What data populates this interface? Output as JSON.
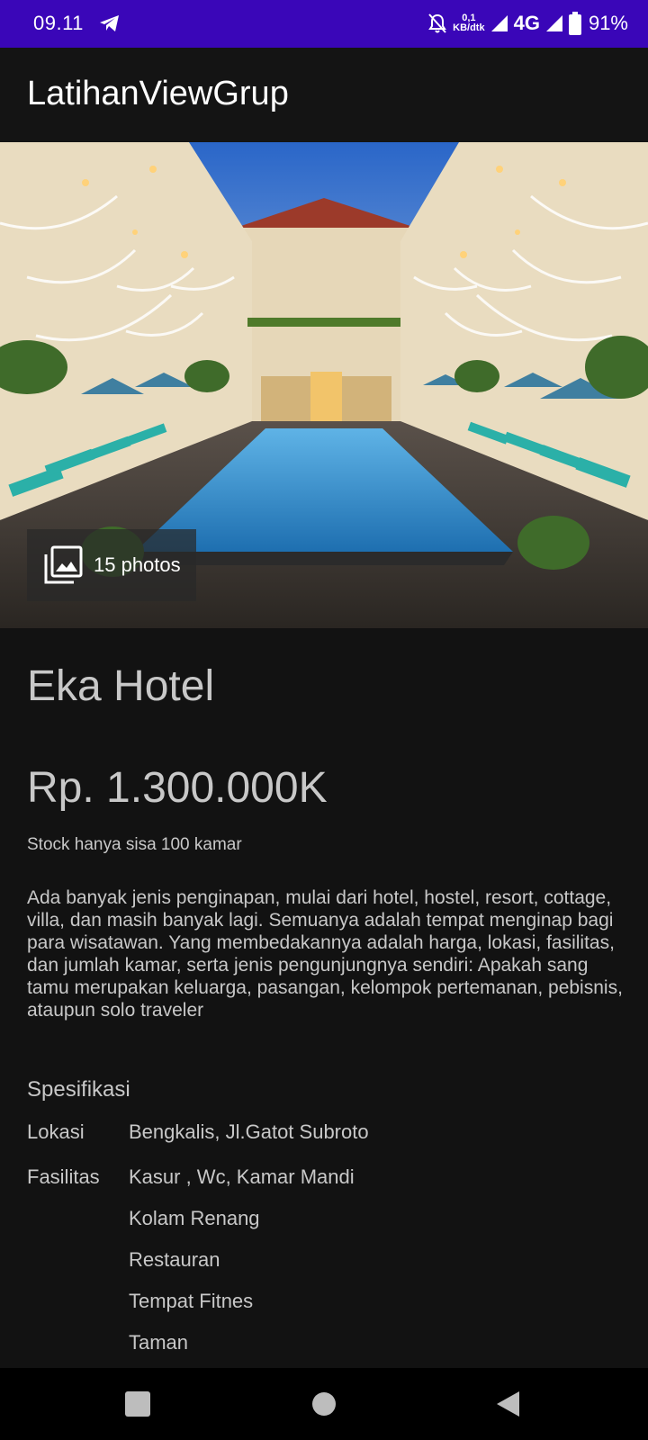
{
  "status_bar": {
    "time": "09.11",
    "net_speed_value": "0,1",
    "net_speed_unit": "KB/dtk",
    "network_type": "4G",
    "battery_percent": "91%",
    "background_color": "#3a06b8"
  },
  "app_bar": {
    "title": "LatihanViewGrup"
  },
  "hero": {
    "photos_label": "15 photos",
    "photos_icon": "photo-library-icon"
  },
  "hotel": {
    "name": "Eka Hotel",
    "price": "Rp. 1.300.000K",
    "stock": "Stock hanya sisa 100 kamar",
    "description": "Ada banyak jenis penginapan, mulai dari hotel, hostel, resort, cottage, villa, dan masih banyak lagi. Semuanya adalah tempat menginap bagi para wisatawan. Yang membedakannya adalah harga, lokasi, fasilitas, dan jumlah kamar, serta jenis pengunjungnya sendiri: Apakah sang tamu merupakan keluarga, pasangan, kelompok pertemanan, pebisnis, ataupun solo traveler"
  },
  "specs": {
    "title": "Spesifikasi",
    "location_label": "Lokasi",
    "location_value": "Bengkalis, Jl.Gatot Subroto",
    "facilities_label": "Fasilitas",
    "facilities": [
      "Kasur , Wc, Kamar Mandi",
      "Kolam Renang",
      "Restauran",
      "Tempat Fitnes",
      "Taman"
    ]
  },
  "nav_bar": {
    "recents_icon": "square-recents-icon",
    "home_icon": "circle-home-icon",
    "back_icon": "triangle-back-icon"
  }
}
